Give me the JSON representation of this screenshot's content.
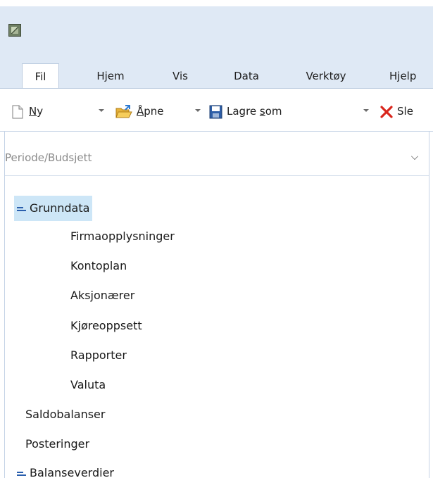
{
  "window": {
    "icon": "app-logo-icon"
  },
  "ribbon": {
    "tabs": [
      {
        "label": "Fil",
        "active": true
      },
      {
        "label": "Hjem",
        "active": false
      },
      {
        "label": "Vis",
        "active": false
      },
      {
        "label": "Data",
        "active": false
      },
      {
        "label": "Verktøy",
        "active": false
      },
      {
        "label": "Hjelp",
        "active": false
      }
    ]
  },
  "toolbar": {
    "new": {
      "prefix": "",
      "mnemonic": "N",
      "suffix": "y",
      "icon": "new-document-icon"
    },
    "open": {
      "prefix": "",
      "mnemonic": "Å",
      "suffix": "pne",
      "icon": "open-folder-icon"
    },
    "save_as": {
      "prefix": "Lagre ",
      "mnemonic": "s",
      "suffix": "om",
      "icon": "save-disk-icon"
    },
    "delete": {
      "label": "Sle",
      "icon": "delete-x-icon"
    }
  },
  "period": {
    "placeholder": "Periode/Budsjett",
    "icon": "chevron-down-icon"
  },
  "tree": {
    "grunndata": {
      "label": "Grunndata",
      "selected": true,
      "icon": "collapse-icon"
    },
    "children": [
      "Firmaopplysninger",
      "Kontoplan",
      "Aksjonærer",
      "Kjøreoppsett",
      "Rapporter",
      "Valuta"
    ],
    "saldobalanser": "Saldobalanser",
    "posteringer": "Posteringer",
    "balanseverdier": {
      "label": "Balanseverdier",
      "icon": "collapse-icon"
    }
  },
  "colors": {
    "ribbon_bg": "#dfe9f5",
    "selection_bg": "#cde6f7",
    "accent": "#2a5fad",
    "delete_red": "#d9261c"
  }
}
